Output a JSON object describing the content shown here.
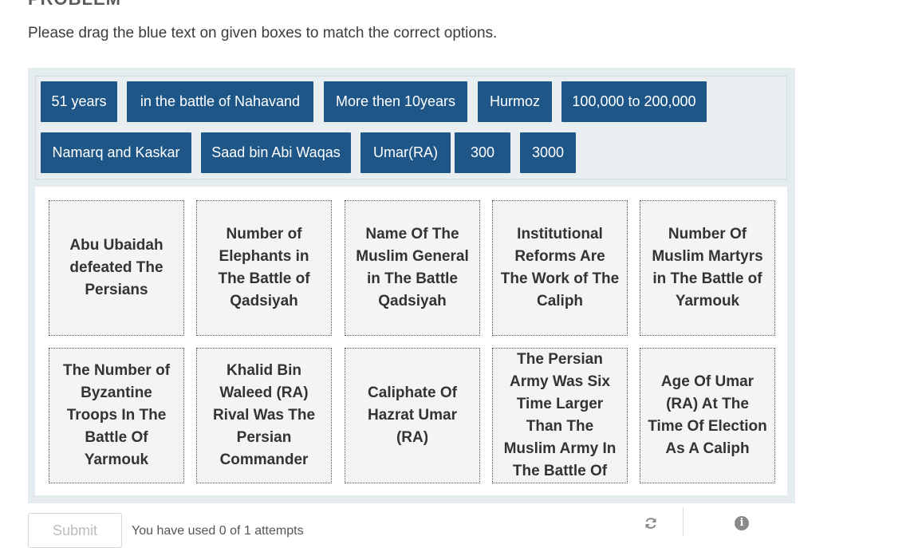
{
  "problem": {
    "heading": "PROBLEM",
    "instructions": "Please drag the blue text on given boxes to match the correct options."
  },
  "options": [
    "51 years",
    "in the battle of Nahavand",
    "More then 10years",
    "Hurmoz",
    "100,000 to 200,000",
    "Namarq and Kaskar",
    "Saad bin Abi Waqas",
    "Umar(RA)",
    "300",
    "3000"
  ],
  "targets": [
    "Abu Ubaidah defeated The Persians",
    "Number of Elephants in The Battle of Qadsiyah",
    "Name Of The Muslim General in The Battle Qadsiyah",
    "Institutional Reforms Are The Work of The Caliph",
    "Number Of Muslim Martyrs in The Battle of Yarmouk",
    "The Number of Byzantine Troops In The Battle Of Yarmouk",
    "Khalid Bin Waleed (RA) Rival Was The Persian Commander",
    "Caliphate Of Hazrat Umar (RA)",
    "The Persian Army Was Six Time Larger Than The Muslim Army In The Battle Of",
    "Age Of Umar (RA) At The Time Of Election As A Caliph"
  ],
  "footer": {
    "submit_label": "Submit",
    "attempts_text": "You have used 0 of 1 attempts",
    "reset_icon": "refresh-icon",
    "info_icon": "info-icon"
  },
  "colors": {
    "option_bg": "#1e5687",
    "pool_bg": "#e9eef1",
    "zone_bg": "#f4f4f4"
  }
}
